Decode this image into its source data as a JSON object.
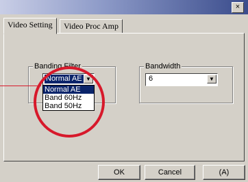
{
  "window": {
    "close_label": "×"
  },
  "tabs": [
    {
      "label": "Video Setting",
      "active": true
    },
    {
      "label": "Video Proc Amp",
      "active": false
    }
  ],
  "banding": {
    "legend": "Banding Filter",
    "selected": "Normal AE",
    "options": [
      "Normal AE",
      "Band 60Hz",
      "Band 50Hz"
    ]
  },
  "bandwidth": {
    "legend": "Bandwidth",
    "selected": "6"
  },
  "buttons": {
    "ok": "OK",
    "cancel": "Cancel",
    "apply": "(A)"
  },
  "colors": {
    "highlight": "#0a246a",
    "annotation": "#d7192b"
  }
}
